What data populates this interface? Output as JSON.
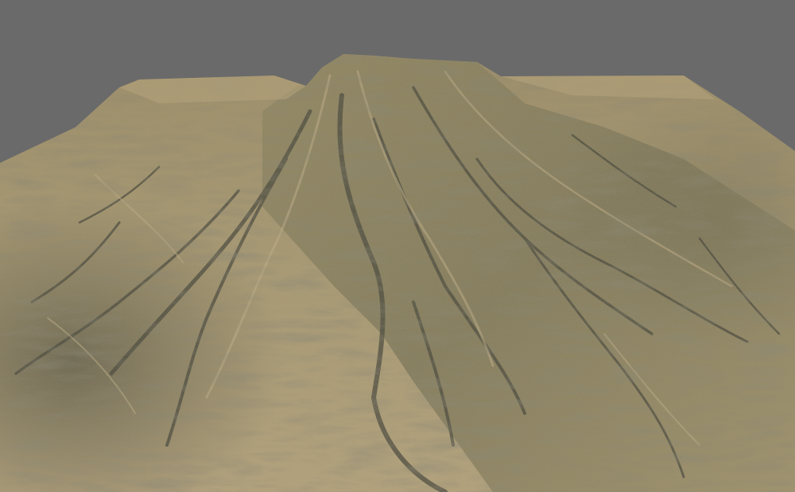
{
  "scene": {
    "subject": "mountain-terrain",
    "colors": {
      "background": "#6a6a6a",
      "terrain_light": "#b3a179",
      "terrain_mid": "#9a8a63",
      "terrain_dark": "#5f5a44",
      "ridge_shadow": "#3f3f35",
      "highlight": "#c7b58d"
    }
  }
}
